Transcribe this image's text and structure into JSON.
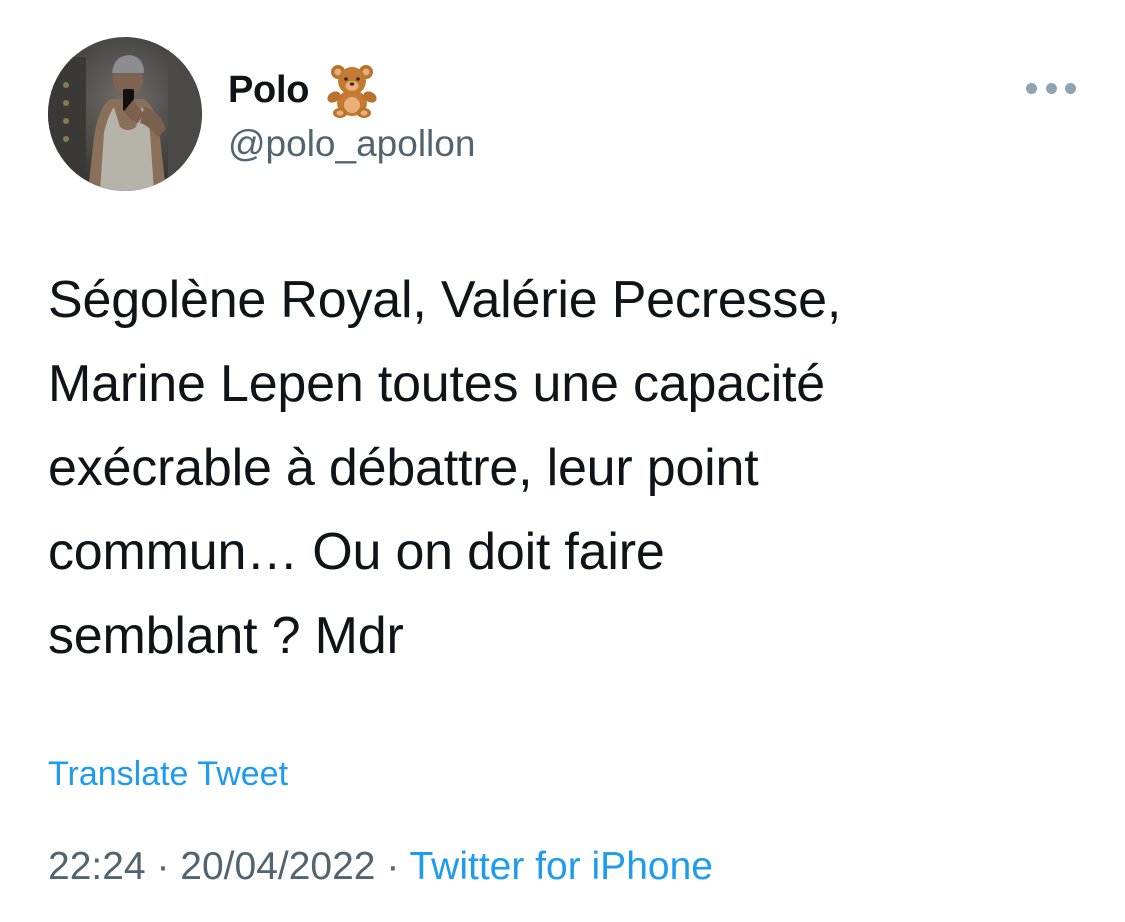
{
  "author": {
    "display_name": "Polo",
    "name_emoji": "teddy-bear-emoji",
    "handle": "@polo_apollon"
  },
  "tweet": {
    "text": "Ségolène Royal, Valérie Pecresse,\nMarine Lepen toutes une capacité\nexécrable à débattre, leur point\ncommun… Ou on doit faire\nsemblant ? Mdr",
    "translate_label": "Translate Tweet",
    "time": "22:24",
    "separator": "·",
    "date": "20/04/2022",
    "source": "Twitter for iPhone"
  },
  "icons": {
    "more": "more-options-icon"
  },
  "colors": {
    "text": "#0f1419",
    "secondary": "#536471",
    "link": "#1d9bf0",
    "dots": "#8fa3b3"
  }
}
